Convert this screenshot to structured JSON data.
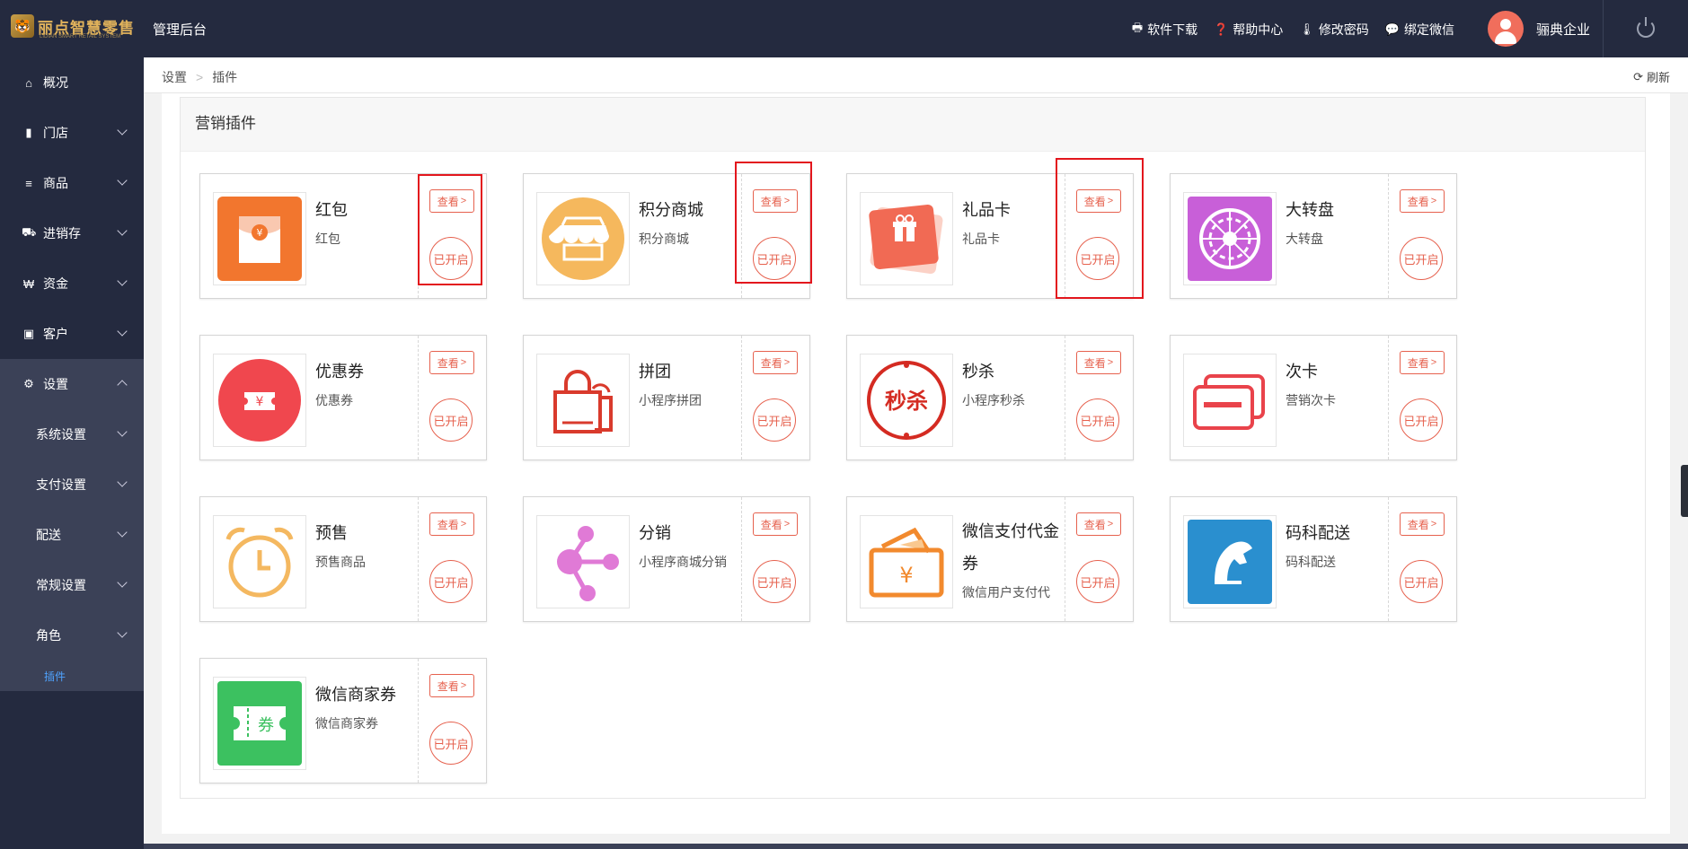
{
  "brand": {
    "name": "丽点智慧零售",
    "subtitle": "LIDIAN SMART RETAIL SYSTEM",
    "logo_icon": "tiger-logo-icon"
  },
  "header": {
    "title": "管理后台",
    "links": [
      {
        "label": "软件下载",
        "icon": "printer-icon",
        "glyph": "🖶"
      },
      {
        "label": "帮助中心",
        "icon": "help-icon",
        "glyph": "❓"
      },
      {
        "label": "修改密码",
        "icon": "thermometer-icon",
        "glyph": "🌡"
      },
      {
        "label": "绑定微信",
        "icon": "chat-icon",
        "glyph": "💬"
      }
    ],
    "user_name": "骊典企业"
  },
  "sidebar": {
    "items": [
      {
        "label": "概况",
        "glyph": "⌂"
      },
      {
        "label": "门店",
        "glyph": "▮"
      },
      {
        "label": "商品",
        "glyph": "≡"
      },
      {
        "label": "进销存",
        "glyph": "⛟"
      },
      {
        "label": "资金",
        "glyph": "₩"
      },
      {
        "label": "客户",
        "glyph": "▣"
      },
      {
        "label": "设置",
        "glyph": "⚙"
      }
    ],
    "sub_items": [
      {
        "label": "系统设置"
      },
      {
        "label": "支付设置"
      },
      {
        "label": "配送"
      },
      {
        "label": "常规设置"
      },
      {
        "label": "角色"
      }
    ],
    "active_leaf": "插件"
  },
  "breadcrumb": {
    "items": [
      "设置",
      "插件"
    ],
    "refresh_label": "刷新"
  },
  "panel": {
    "title": "营销插件"
  },
  "buttons": {
    "view_label": "查看",
    "view_arrow": ">",
    "enabled_label": "已开启"
  },
  "plugins": [
    {
      "title": "红包",
      "desc": "红包"
    },
    {
      "title": "积分商城",
      "desc": "积分商城"
    },
    {
      "title": "礼品卡",
      "desc": "礼品卡"
    },
    {
      "title": "大转盘",
      "desc": "大转盘"
    },
    {
      "title": "优惠券",
      "desc": "优惠券"
    },
    {
      "title": "拼团",
      "desc": "小程序拼团"
    },
    {
      "title": "秒杀",
      "desc": "小程序秒杀",
      "icon_text": "秒杀"
    },
    {
      "title": "次卡",
      "desc": "营销次卡"
    },
    {
      "title": "预售",
      "desc": "预售商品"
    },
    {
      "title": "分销",
      "desc": "小程序商城分销"
    },
    {
      "title": "微信支付代金券",
      "desc": "微信用户支付代金券"
    },
    {
      "title": "码科配送",
      "desc": "码科配送"
    },
    {
      "title": "微信商家券",
      "desc": "微信商家券",
      "icon_text": "券"
    }
  ],
  "colors": {
    "sidebar_bg": "#242a3f",
    "accent": "#e6614e",
    "highlight": "#e3161d",
    "active_link": "#4fa3ff"
  }
}
